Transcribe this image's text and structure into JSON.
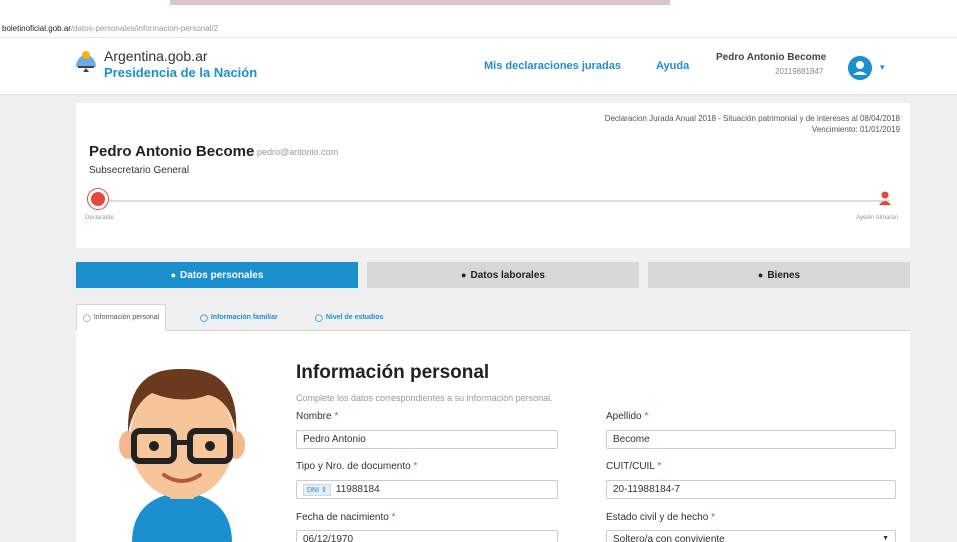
{
  "browser": {
    "url_host": "boletinoficial.gob.ar",
    "url_path": "/datos-personales/informacion-personal/2"
  },
  "header": {
    "brand_top": "Argentina.gob.ar",
    "brand_bottom": "Presidencia de la Nación",
    "nav": [
      {
        "label": "Mis declaraciones juradas"
      },
      {
        "label": "Ayuda"
      }
    ],
    "user_name": "Pedro Antonio Become",
    "user_id": "20119881847",
    "caret": "▾"
  },
  "declaration": {
    "line1": "Declaracion Jurada Anual 2018 - Situación patrimonial y de intereses al 08/04/2018",
    "line2": "Vencimiento: 01/01/2019",
    "name": "Pedro Antonio Become",
    "email": "pedro@antonio.com",
    "role": "Subsecretario General",
    "progress_left": "Declarante",
    "progress_right": "Ayelén Almarán"
  },
  "steps": [
    {
      "label": "Datos personales",
      "icon": "check-circle-icon"
    },
    {
      "label": "Datos laborales",
      "icon": "plus-circle-icon"
    },
    {
      "label": "Bienes",
      "icon": "plus-circle-icon"
    }
  ],
  "subtabs": [
    {
      "label": "Información personal"
    },
    {
      "label": "Información familiar"
    },
    {
      "label": "Nivel de estudios"
    }
  ],
  "form": {
    "title": "Información personal",
    "description": "Complete los datos correspondientes a su información personal.",
    "required_mark": "*",
    "fields": {
      "nombre": {
        "label": "Nombre",
        "value": "Pedro Antonio"
      },
      "apellido": {
        "label": "Apellido",
        "value": "Become"
      },
      "documento": {
        "label": "Tipo y Nro. de documento",
        "type": "DNI ⇕",
        "value": "11988184"
      },
      "cuit": {
        "label": "CUIT/CUIL",
        "value": "20-11988184-7"
      },
      "nacimiento": {
        "label": "Fecha de nacimiento",
        "value": "06/12/1970"
      },
      "estado_civil": {
        "label": "Estado civil y de hecho",
        "value": "Soltero/a con conviviente",
        "arrow": "▼"
      }
    }
  },
  "colors": {
    "accent": "#1c8fcf",
    "danger": "#e8453c",
    "inactive_step": "#d8d8d8"
  }
}
